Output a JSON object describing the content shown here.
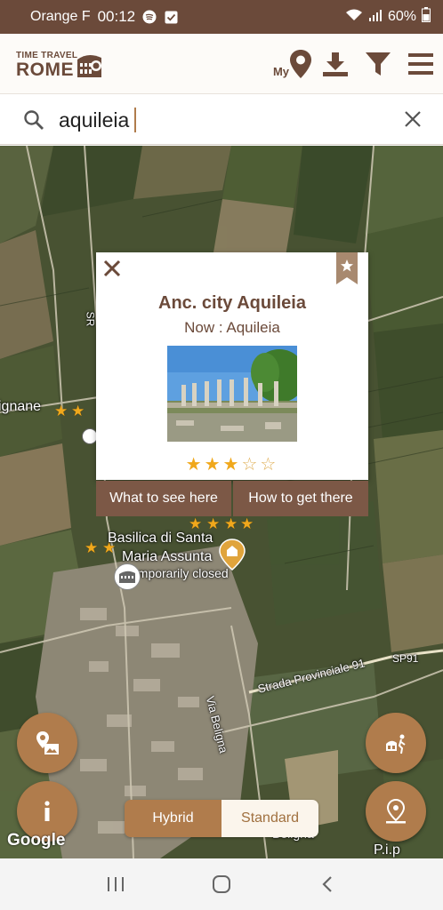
{
  "status": {
    "carrier": "Orange F",
    "time": "00:12",
    "battery": "60%"
  },
  "header": {
    "logo_small": "TIME TRAVEL",
    "logo_big": "ROME",
    "my_label": "My"
  },
  "search": {
    "value": "aquileia"
  },
  "popup": {
    "title": "Anc. city Aquileia",
    "now_prefix": "Now :",
    "now_value": "Aquileia",
    "rating": 3,
    "rating_max": 5,
    "what_to_see": "What to see here",
    "how_to_get": "How to get there"
  },
  "map": {
    "labels": {
      "ignane": "ignane",
      "basilica_line1": "Basilica di Santa",
      "basilica_line2": "Maria Assunta",
      "closed": "Temporarily closed",
      "sr": "SR",
      "sp91": "SP91",
      "strada": "Strada Provinciale 91",
      "via_beligna": "Via Beligna",
      "beligna": "Beligna",
      "pip": "P.i.p"
    },
    "attribution": "Google"
  },
  "map_mode": {
    "hybrid": "Hybrid",
    "standard": "Standard",
    "selected": "Hybrid"
  },
  "colors": {
    "brown": "#6b4a3a",
    "accent": "#b07c4c",
    "star": "#f0a81c"
  }
}
